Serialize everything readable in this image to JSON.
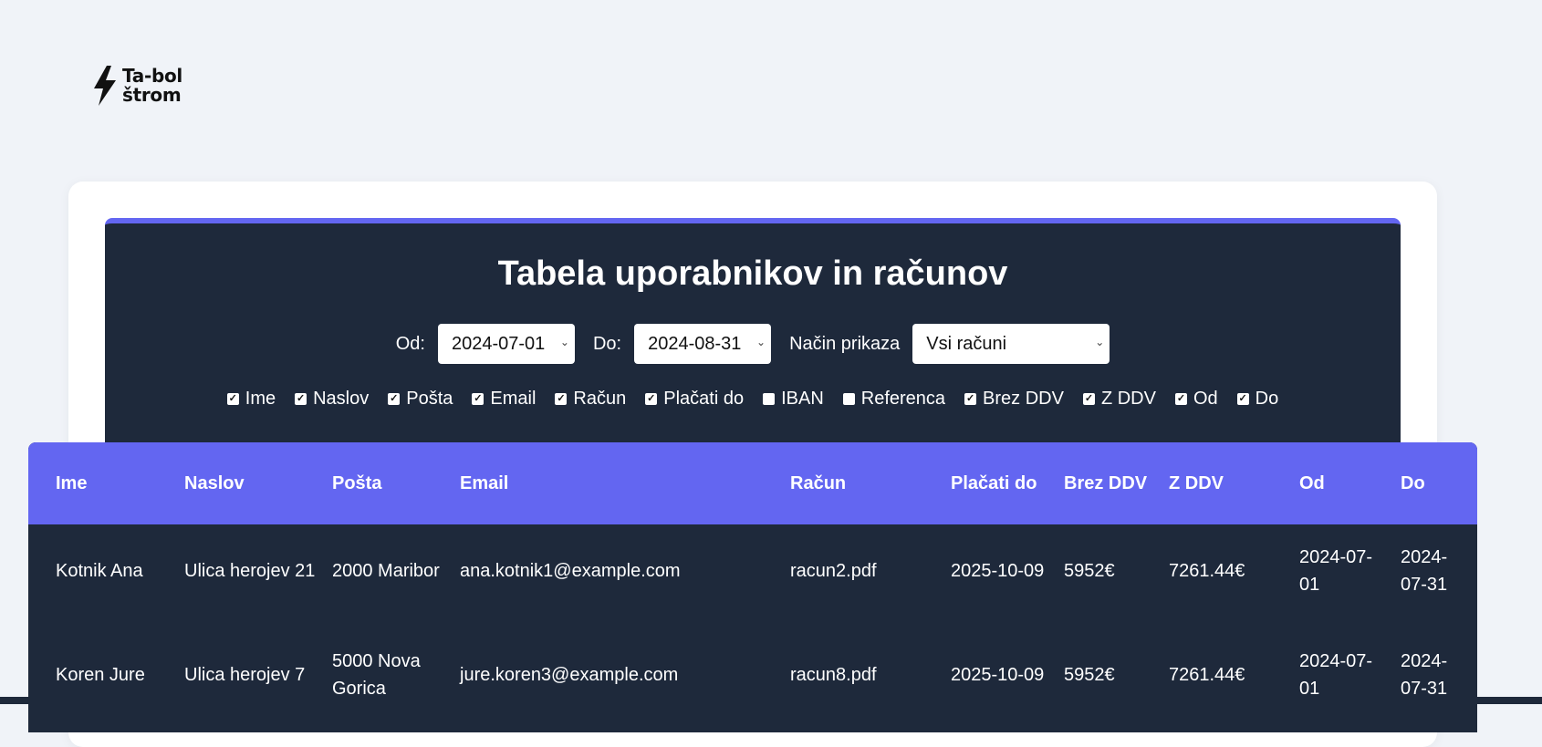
{
  "logo": {
    "line1": "Ta-bol",
    "line2": "štrom",
    "icon": "lightning-bolt-icon"
  },
  "title": "Tabela uporabnikov in računov",
  "filters": {
    "from_label": "Od:",
    "from_value": "2024-07-01",
    "to_label": "Do:",
    "to_value": "2024-08-31",
    "mode_label": "Način prikaza",
    "mode_value": "Vsi računi"
  },
  "columns_toggle": [
    {
      "label": "Ime",
      "checked": true
    },
    {
      "label": "Naslov",
      "checked": true
    },
    {
      "label": "Pošta",
      "checked": true
    },
    {
      "label": "Email",
      "checked": true
    },
    {
      "label": "Račun",
      "checked": true
    },
    {
      "label": "Plačati do",
      "checked": true
    },
    {
      "label": "IBAN",
      "checked": false
    },
    {
      "label": "Referenca",
      "checked": false
    },
    {
      "label": "Brez DDV",
      "checked": true
    },
    {
      "label": "Z DDV",
      "checked": true
    },
    {
      "label": "Od",
      "checked": true
    },
    {
      "label": "Do",
      "checked": true
    }
  ],
  "table": {
    "headers": [
      "Ime",
      "Naslov",
      "Pošta",
      "Email",
      "Račun",
      "Plačati do",
      "Brez DDV",
      "Z DDV",
      "Od",
      "Do"
    ],
    "rows": [
      [
        "Kotnik Ana",
        "Ulica herojev 21",
        "2000 Maribor",
        "ana.kotnik1@example.com",
        "racun2.pdf",
        "2025-10-09",
        "5952€",
        "7261.44€",
        "2024-07-01",
        "2024-07-31"
      ],
      [
        "Koren Jure",
        "Ulica herojev 7",
        "5000 Nova Gorica",
        "jure.koren3@example.com",
        "racun8.pdf",
        "2025-10-09",
        "5952€",
        "7261.44€",
        "2024-07-01",
        "2024-07-31"
      ]
    ]
  },
  "colors": {
    "accent": "#6366f1",
    "panel": "#1e293b",
    "background": "#f0f3f8"
  }
}
